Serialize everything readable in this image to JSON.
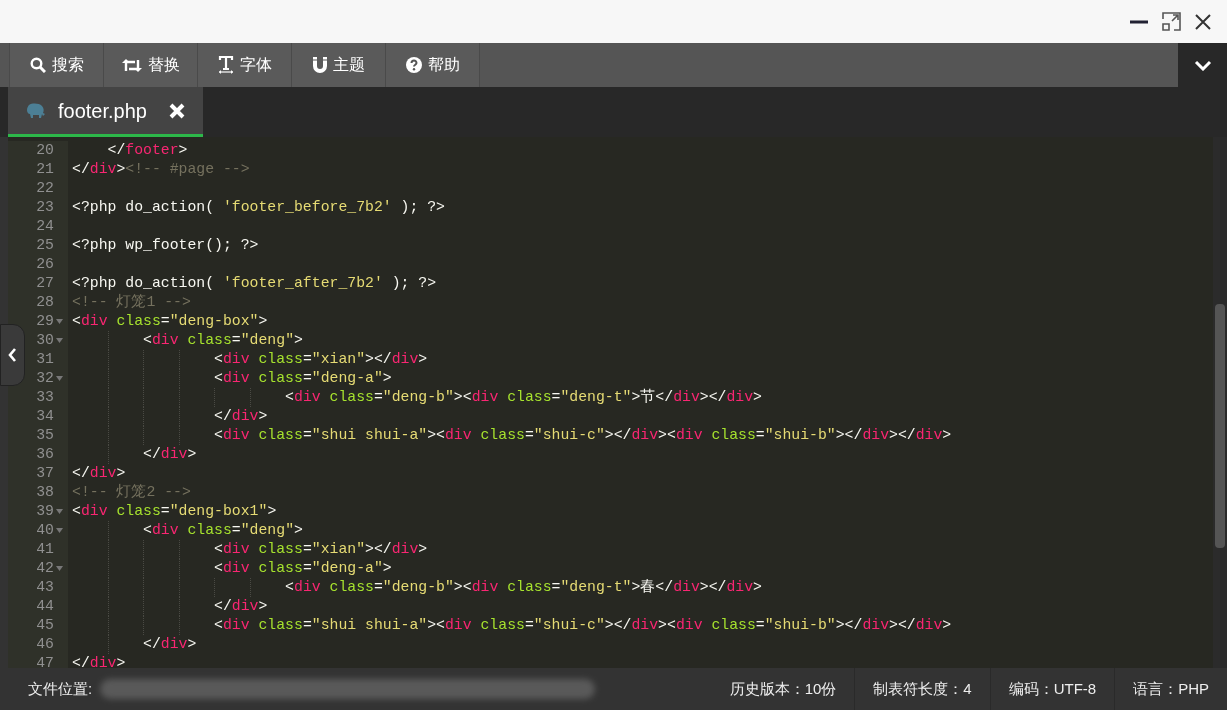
{
  "toolbar": [
    {
      "label": "搜索"
    },
    {
      "label": "替换"
    },
    {
      "label": "字体"
    },
    {
      "label": "主题"
    },
    {
      "label": "帮助"
    }
  ],
  "tabs": [
    {
      "label": "footer.php",
      "selected": true
    }
  ],
  "editor": {
    "lines": [
      {
        "number": "20",
        "foldable": false,
        "tokens": [
          {
            "kind": "plain",
            "text": "    </"
          },
          {
            "kind": "tag",
            "text": "footer"
          },
          {
            "kind": "plain",
            "text": ">"
          }
        ]
      },
      {
        "number": "21",
        "foldable": false,
        "tokens": [
          {
            "kind": "plain",
            "text": "</"
          },
          {
            "kind": "tag",
            "text": "div"
          },
          {
            "kind": "plain",
            "text": ">"
          },
          {
            "kind": "comment",
            "text": "<!-- #page -->"
          }
        ]
      },
      {
        "number": "22",
        "foldable": false
      },
      {
        "number": "23",
        "foldable": false,
        "tokens": [
          {
            "kind": "plain",
            "text": "<?php do_action( "
          },
          {
            "kind": "string",
            "text": "'footer_before_7b2'"
          },
          {
            "kind": "plain",
            "text": " ); ?>"
          }
        ]
      },
      {
        "number": "24",
        "foldable": false
      },
      {
        "number": "25",
        "foldable": false,
        "tokens": [
          {
            "kind": "plain",
            "text": "<?php wp_footer(); ?>"
          }
        ]
      },
      {
        "number": "26",
        "foldable": false
      },
      {
        "number": "27",
        "foldable": false,
        "tokens": [
          {
            "kind": "plain",
            "text": "<?php do_action( "
          },
          {
            "kind": "string",
            "text": "'footer_after_7b2'"
          },
          {
            "kind": "plain",
            "text": " ); ?>"
          }
        ]
      },
      {
        "number": "28",
        "foldable": false,
        "tokens": [
          {
            "kind": "comment",
            "text": "<!-- 灯笼1 -->"
          }
        ]
      },
      {
        "number": "29",
        "foldable": true,
        "tokens": [
          {
            "kind": "plain",
            "text": "<"
          },
          {
            "kind": "tag",
            "text": "div"
          },
          {
            "kind": "attr",
            "text": " class"
          },
          {
            "kind": "plain",
            "text": "="
          },
          {
            "kind": "string",
            "text": "\"deng-box\""
          },
          {
            "kind": "plain",
            "text": ">"
          }
        ]
      },
      {
        "number": "30",
        "foldable": true,
        "tokens": [
          {
            "kind": "plain",
            "text": "        <"
          },
          {
            "kind": "tag",
            "text": "div"
          },
          {
            "kind": "attr",
            "text": " class"
          },
          {
            "kind": "plain",
            "text": "="
          },
          {
            "kind": "string",
            "text": "\"deng\""
          },
          {
            "kind": "plain",
            "text": ">"
          }
        ]
      },
      {
        "number": "31",
        "foldable": false,
        "tokens": [
          {
            "kind": "plain",
            "text": "                <"
          },
          {
            "kind": "tag",
            "text": "div"
          },
          {
            "kind": "attr",
            "text": " class"
          },
          {
            "kind": "plain",
            "text": "="
          },
          {
            "kind": "string",
            "text": "\"xian\""
          },
          {
            "kind": "plain",
            "text": "></"
          },
          {
            "kind": "tag",
            "text": "div"
          },
          {
            "kind": "plain",
            "text": ">"
          }
        ]
      },
      {
        "number": "32",
        "foldable": true,
        "tokens": [
          {
            "kind": "plain",
            "text": "                <"
          },
          {
            "kind": "tag",
            "text": "div"
          },
          {
            "kind": "attr",
            "text": " class"
          },
          {
            "kind": "plain",
            "text": "="
          },
          {
            "kind": "string",
            "text": "\"deng-a\""
          },
          {
            "kind": "plain",
            "text": ">"
          }
        ]
      },
      {
        "number": "33",
        "foldable": false,
        "tokens": [
          {
            "kind": "plain",
            "text": "                        <"
          },
          {
            "kind": "tag",
            "text": "div"
          },
          {
            "kind": "attr",
            "text": " class"
          },
          {
            "kind": "plain",
            "text": "="
          },
          {
            "kind": "string",
            "text": "\"deng-b\""
          },
          {
            "kind": "plain",
            "text": "><"
          },
          {
            "kind": "tag",
            "text": "div"
          },
          {
            "kind": "attr",
            "text": " class"
          },
          {
            "kind": "plain",
            "text": "="
          },
          {
            "kind": "string",
            "text": "\"deng-t\""
          },
          {
            "kind": "plain",
            "text": ">节</"
          },
          {
            "kind": "tag",
            "text": "div"
          },
          {
            "kind": "plain",
            "text": "></"
          },
          {
            "kind": "tag",
            "text": "div"
          },
          {
            "kind": "plain",
            "text": ">"
          }
        ]
      },
      {
        "number": "34",
        "foldable": false,
        "tokens": [
          {
            "kind": "plain",
            "text": "                </"
          },
          {
            "kind": "tag",
            "text": "div"
          },
          {
            "kind": "plain",
            "text": ">"
          }
        ]
      },
      {
        "number": "35",
        "foldable": false,
        "tokens": [
          {
            "kind": "plain",
            "text": "                <"
          },
          {
            "kind": "tag",
            "text": "div"
          },
          {
            "kind": "attr",
            "text": " class"
          },
          {
            "kind": "plain",
            "text": "="
          },
          {
            "kind": "string",
            "text": "\"shui shui-a\""
          },
          {
            "kind": "plain",
            "text": "><"
          },
          {
            "kind": "tag",
            "text": "div"
          },
          {
            "kind": "attr",
            "text": " class"
          },
          {
            "kind": "plain",
            "text": "="
          },
          {
            "kind": "string",
            "text": "\"shui-c\""
          },
          {
            "kind": "plain",
            "text": "></"
          },
          {
            "kind": "tag",
            "text": "div"
          },
          {
            "kind": "plain",
            "text": "><"
          },
          {
            "kind": "tag",
            "text": "div"
          },
          {
            "kind": "attr",
            "text": " class"
          },
          {
            "kind": "plain",
            "text": "="
          },
          {
            "kind": "string",
            "text": "\"shui-b\""
          },
          {
            "kind": "plain",
            "text": "></"
          },
          {
            "kind": "tag",
            "text": "div"
          },
          {
            "kind": "plain",
            "text": "></"
          },
          {
            "kind": "tag",
            "text": "div"
          },
          {
            "kind": "plain",
            "text": ">"
          }
        ]
      },
      {
        "number": "36",
        "foldable": false,
        "tokens": [
          {
            "kind": "plain",
            "text": "        </"
          },
          {
            "kind": "tag",
            "text": "div"
          },
          {
            "kind": "plain",
            "text": ">"
          }
        ]
      },
      {
        "number": "37",
        "foldable": false,
        "tokens": [
          {
            "kind": "plain",
            "text": "</"
          },
          {
            "kind": "tag",
            "text": "div"
          },
          {
            "kind": "plain",
            "text": ">"
          }
        ]
      },
      {
        "number": "38",
        "foldable": false,
        "tokens": [
          {
            "kind": "comment",
            "text": "<!-- 灯笼2 -->"
          }
        ]
      },
      {
        "number": "39",
        "foldable": true,
        "tokens": [
          {
            "kind": "plain",
            "text": "<"
          },
          {
            "kind": "tag",
            "text": "div"
          },
          {
            "kind": "attr",
            "text": " class"
          },
          {
            "kind": "plain",
            "text": "="
          },
          {
            "kind": "string",
            "text": "\"deng-box1\""
          },
          {
            "kind": "plain",
            "text": ">"
          }
        ]
      },
      {
        "number": "40",
        "foldable": true,
        "tokens": [
          {
            "kind": "plain",
            "text": "        <"
          },
          {
            "kind": "tag",
            "text": "div"
          },
          {
            "kind": "attr",
            "text": " class"
          },
          {
            "kind": "plain",
            "text": "="
          },
          {
            "kind": "string",
            "text": "\"deng\""
          },
          {
            "kind": "plain",
            "text": ">"
          }
        ]
      },
      {
        "number": "41",
        "foldable": false,
        "tokens": [
          {
            "kind": "plain",
            "text": "                <"
          },
          {
            "kind": "tag",
            "text": "div"
          },
          {
            "kind": "attr",
            "text": " class"
          },
          {
            "kind": "plain",
            "text": "="
          },
          {
            "kind": "string",
            "text": "\"xian\""
          },
          {
            "kind": "plain",
            "text": "></"
          },
          {
            "kind": "tag",
            "text": "div"
          },
          {
            "kind": "plain",
            "text": ">"
          }
        ]
      },
      {
        "number": "42",
        "foldable": true,
        "tokens": [
          {
            "kind": "plain",
            "text": "                <"
          },
          {
            "kind": "tag",
            "text": "div"
          },
          {
            "kind": "attr",
            "text": " class"
          },
          {
            "kind": "plain",
            "text": "="
          },
          {
            "kind": "string",
            "text": "\"deng-a\""
          },
          {
            "kind": "plain",
            "text": ">"
          }
        ]
      },
      {
        "number": "43",
        "foldable": false,
        "tokens": [
          {
            "kind": "plain",
            "text": "                        <"
          },
          {
            "kind": "tag",
            "text": "div"
          },
          {
            "kind": "attr",
            "text": " class"
          },
          {
            "kind": "plain",
            "text": "="
          },
          {
            "kind": "string",
            "text": "\"deng-b\""
          },
          {
            "kind": "plain",
            "text": "><"
          },
          {
            "kind": "tag",
            "text": "div"
          },
          {
            "kind": "attr",
            "text": " class"
          },
          {
            "kind": "plain",
            "text": "="
          },
          {
            "kind": "string",
            "text": "\"deng-t\""
          },
          {
            "kind": "plain",
            "text": ">春</"
          },
          {
            "kind": "tag",
            "text": "div"
          },
          {
            "kind": "plain",
            "text": "></"
          },
          {
            "kind": "tag",
            "text": "div"
          },
          {
            "kind": "plain",
            "text": ">"
          }
        ]
      },
      {
        "number": "44",
        "foldable": false,
        "tokens": [
          {
            "kind": "plain",
            "text": "                </"
          },
          {
            "kind": "tag",
            "text": "div"
          },
          {
            "kind": "plain",
            "text": ">"
          }
        ]
      },
      {
        "number": "45",
        "foldable": false,
        "tokens": [
          {
            "kind": "plain",
            "text": "                <"
          },
          {
            "kind": "tag",
            "text": "div"
          },
          {
            "kind": "attr",
            "text": " class"
          },
          {
            "kind": "plain",
            "text": "="
          },
          {
            "kind": "string",
            "text": "\"shui shui-a\""
          },
          {
            "kind": "plain",
            "text": "><"
          },
          {
            "kind": "tag",
            "text": "div"
          },
          {
            "kind": "attr",
            "text": " class"
          },
          {
            "kind": "plain",
            "text": "="
          },
          {
            "kind": "string",
            "text": "\"shui-c\""
          },
          {
            "kind": "plain",
            "text": "></"
          },
          {
            "kind": "tag",
            "text": "div"
          },
          {
            "kind": "plain",
            "text": "><"
          },
          {
            "kind": "tag",
            "text": "div"
          },
          {
            "kind": "attr",
            "text": " class"
          },
          {
            "kind": "plain",
            "text": "="
          },
          {
            "kind": "string",
            "text": "\"shui-b\""
          },
          {
            "kind": "plain",
            "text": "></"
          },
          {
            "kind": "tag",
            "text": "div"
          },
          {
            "kind": "plain",
            "text": "></"
          },
          {
            "kind": "tag",
            "text": "div"
          },
          {
            "kind": "plain",
            "text": ">"
          }
        ]
      },
      {
        "number": "46",
        "foldable": false,
        "tokens": [
          {
            "kind": "plain",
            "text": "        </"
          },
          {
            "kind": "tag",
            "text": "div"
          },
          {
            "kind": "plain",
            "text": ">"
          }
        ]
      },
      {
        "number": "47",
        "foldable": false,
        "tokens": [
          {
            "kind": "plain",
            "text": "</"
          },
          {
            "kind": "tag",
            "text": "div"
          },
          {
            "kind": "plain",
            "text": ">"
          }
        ]
      }
    ]
  },
  "status_bar": {
    "file_location_label": "文件位置:",
    "items": [
      "历史版本：10份",
      "制表符长度：4",
      "编码：UTF-8",
      "语言：PHP"
    ]
  }
}
